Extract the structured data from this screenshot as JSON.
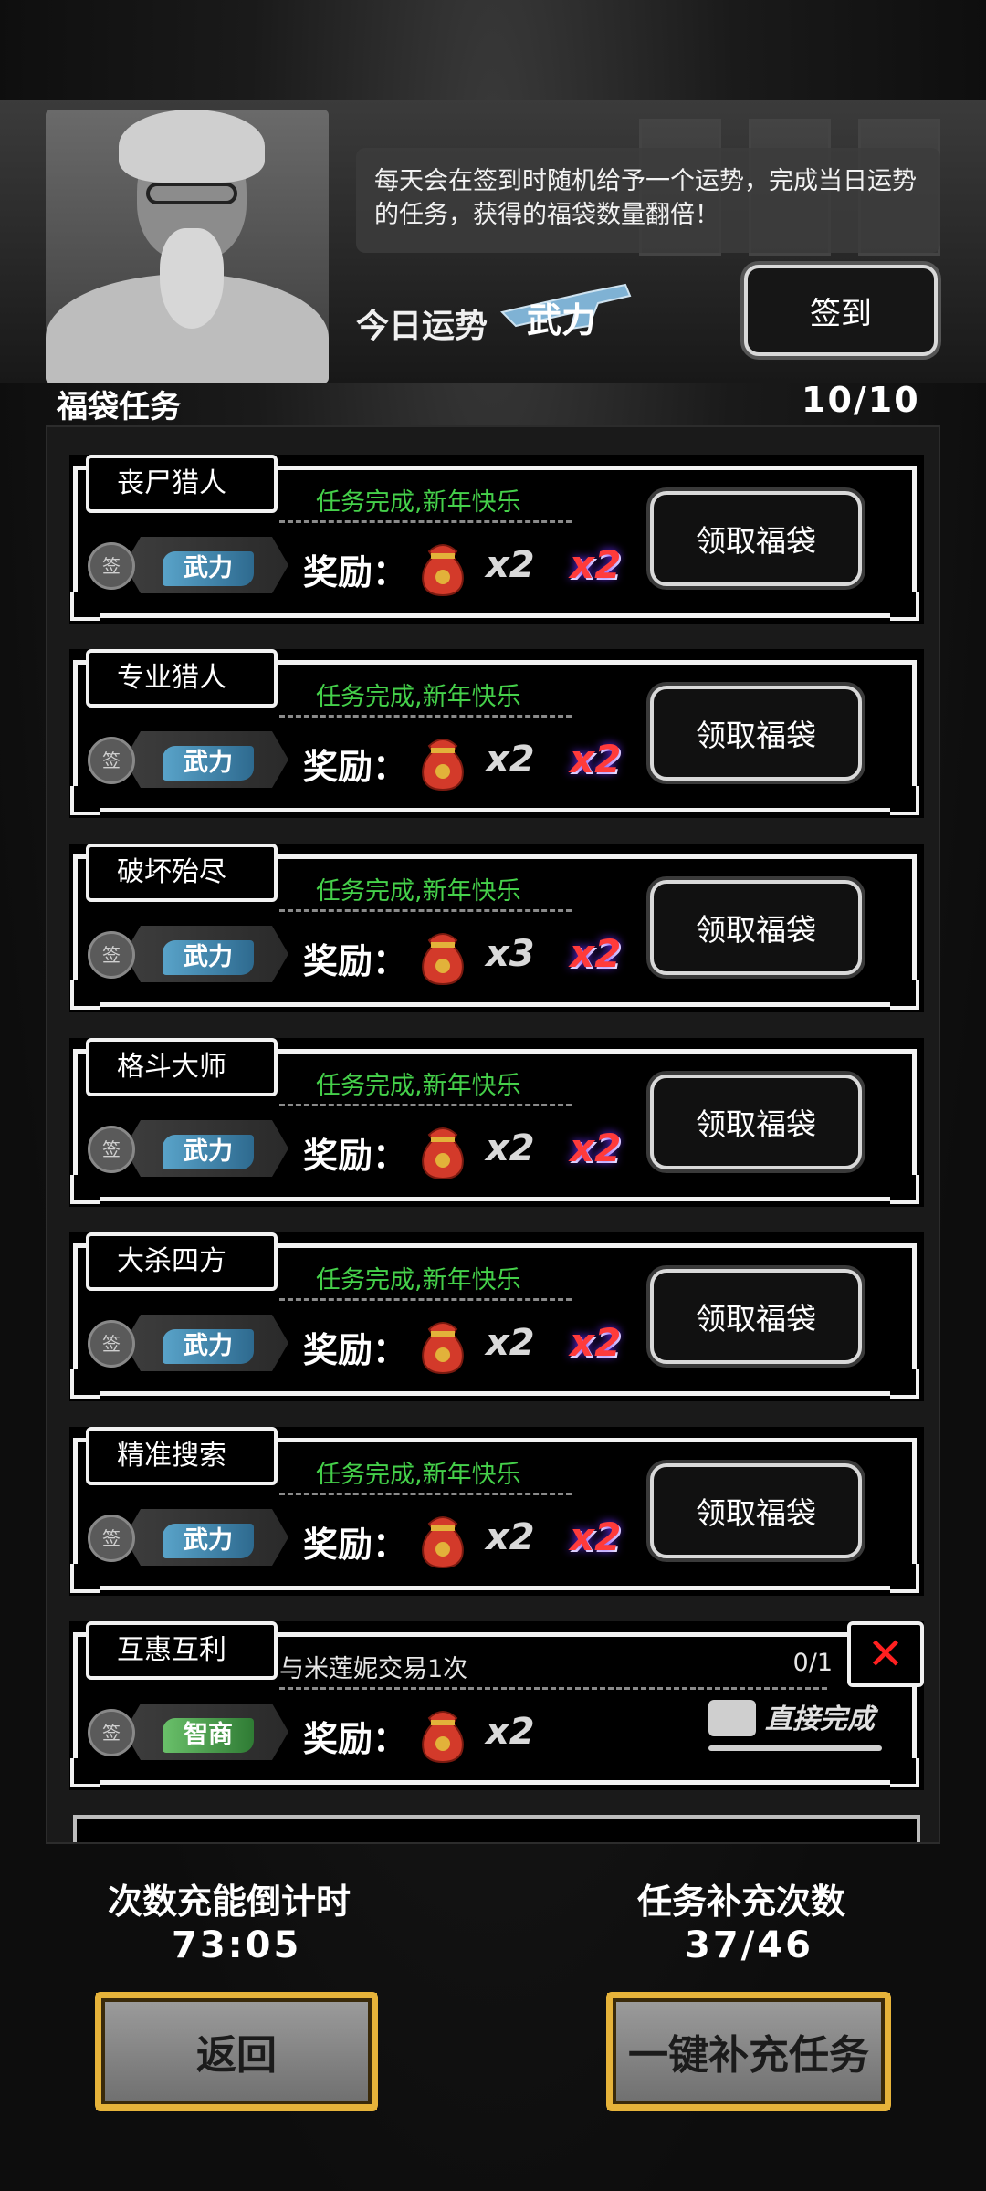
{
  "header": {
    "info_text": "每天会在签到时随机给予一个运势，完成当日运势的任务，获得的福袋数量翻倍！",
    "fortune_label": "今日运势",
    "fortune_value": "武力",
    "checkin_label": "签到"
  },
  "section": {
    "title": "福袋任务",
    "count": "10/10"
  },
  "tasks": [
    {
      "name": "丧尸猎人",
      "status": "任务完成,新年快乐",
      "attr_seal": "签",
      "attr": "武力",
      "reward_label": "奖励：",
      "mult": "x2",
      "double": "x2",
      "button": "领取福袋"
    },
    {
      "name": "专业猎人",
      "status": "任务完成,新年快乐",
      "attr_seal": "签",
      "attr": "武力",
      "reward_label": "奖励：",
      "mult": "x2",
      "double": "x2",
      "button": "领取福袋"
    },
    {
      "name": "破坏殆尽",
      "status": "任务完成,新年快乐",
      "attr_seal": "签",
      "attr": "武力",
      "reward_label": "奖励：",
      "mult": "x3",
      "double": "x2",
      "button": "领取福袋"
    },
    {
      "name": "格斗大师",
      "status": "任务完成,新年快乐",
      "attr_seal": "签",
      "attr": "武力",
      "reward_label": "奖励：",
      "mult": "x2",
      "double": "x2",
      "button": "领取福袋"
    },
    {
      "name": "大杀四方",
      "status": "任务完成,新年快乐",
      "attr_seal": "签",
      "attr": "武力",
      "reward_label": "奖励：",
      "mult": "x2",
      "double": "x2",
      "button": "领取福袋"
    },
    {
      "name": "精准搜索",
      "status": "任务完成,新年快乐",
      "attr_seal": "签",
      "attr": "武力",
      "reward_label": "奖励：",
      "mult": "x2",
      "double": "x2",
      "button": "领取福袋"
    },
    {
      "name": "互惠互利",
      "status": "与米莲妮交易1次",
      "progress": "0/1",
      "attr_seal": "签",
      "attr": "智商",
      "reward_label": "奖励：",
      "mult": "x2",
      "direct_label": "直接完成"
    }
  ],
  "footer": {
    "countdown_title": "次数充能倒计时",
    "countdown_value": "73:05",
    "refill_title": "任务补充次数",
    "refill_value": "37/46",
    "back_label": "返回",
    "refill_all_label": "一键补充任务"
  },
  "colors": {
    "status_green": "#45d04a",
    "double_red": "#ff3b3b",
    "gold_frame": "#e6b33a"
  }
}
